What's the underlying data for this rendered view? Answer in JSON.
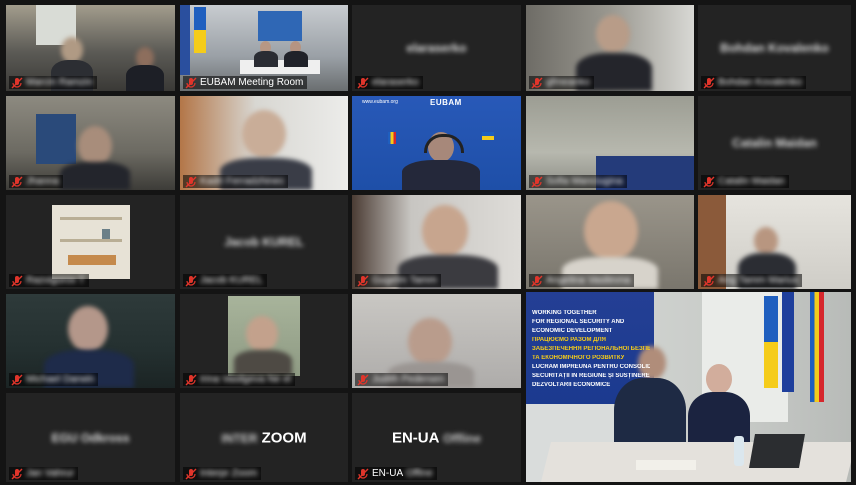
{
  "meeting": {
    "app": "ZOOM",
    "tiles": [
      {
        "id": "t1",
        "name": "Marcin Ramzin",
        "blurred": true,
        "video": true,
        "muted": true
      },
      {
        "id": "t2",
        "name": "EUBAM Meeting Room",
        "blurred": false,
        "video": true,
        "muted": true
      },
      {
        "id": "t3",
        "name": "elaraserko",
        "blurred": true,
        "video": false,
        "muted": true,
        "center_text": "elaraserko"
      },
      {
        "id": "t4",
        "name": "gfmeanko",
        "blurred": true,
        "video": true,
        "muted": true
      },
      {
        "id": "t5",
        "name": "Bohdan Kovalenko",
        "blurred": true,
        "video": false,
        "muted": true,
        "center_text": "Bohdan Kovalenko"
      },
      {
        "id": "t6",
        "name": "Jhanna",
        "blurred": true,
        "video": true,
        "muted": true
      },
      {
        "id": "t7",
        "name": "Kadri Ferradzhinec",
        "blurred": true,
        "video": true,
        "muted": true
      },
      {
        "id": "t8",
        "name": "",
        "blurred": false,
        "video": true,
        "muted": false,
        "banner_title": "EUBAM",
        "banner_url": "www.eubam.org"
      },
      {
        "id": "t9",
        "name": "Sofia Manciugina",
        "blurred": true,
        "video": true,
        "muted": true
      },
      {
        "id": "t10",
        "name": "Catalin Maidan",
        "blurred": true,
        "video": false,
        "muted": true,
        "center_text": "Catalin Maidan"
      },
      {
        "id": "t11",
        "name": "Razvigorov T",
        "blurred": true,
        "video": true,
        "muted": true
      },
      {
        "id": "t12",
        "name": "Jacob KUREL",
        "blurred": true,
        "video": false,
        "muted": true,
        "center_text": "Jacob KUREL"
      },
      {
        "id": "t13",
        "name": "Gugelm Tamm",
        "blurred": true,
        "video": true,
        "muted": true
      },
      {
        "id": "t14",
        "name": "Angelina Vasilevna",
        "blurred": true,
        "video": true,
        "muted": true
      },
      {
        "id": "t15",
        "name": "Ang Tamm Marius",
        "blurred": true,
        "video": true,
        "muted": true
      },
      {
        "id": "t16",
        "name": "Michael Darwin",
        "blurred": true,
        "video": true,
        "muted": true
      },
      {
        "id": "t17",
        "name": "Irina Vasilgeva Ne el",
        "blurred": true,
        "video": true,
        "muted": true
      },
      {
        "id": "t18",
        "name": "Judith Pedersen",
        "blurred": true,
        "video": true,
        "muted": true
      },
      {
        "id": "t19",
        "name": "",
        "blurred": false,
        "video": true,
        "muted": false,
        "slide_lines": [
          "WORKING TOGETHER",
          "FOR REGIONAL SECURITY AND",
          "ECONOMIC DEVELOPMENT",
          "ПРАЦЮЄМО РАЗОМ ДЛЯ",
          "ЗАБЕЗПЕЧЕННЯ РЕГІОНАЛЬНОЇ БЕЗПЕКИ",
          "ТА ЕКОНОМІЧНОГО РОЗВИТКУ",
          "LUCRĂM ÎMPREUNĂ PENTRU CONSOLIDAREA",
          "SECURITĂȚII ÎN REGIUNE ȘI SUSȚINEREA",
          "DEZVOLTĂRII ECONOMICE"
        ]
      },
      {
        "id": "t20",
        "name": "Jan Vahrur",
        "blurred": true,
        "video": false,
        "muted": true,
        "center_text": "EGU Odkross"
      },
      {
        "id": "t21",
        "name": "Interpr Zoom",
        "blurred": true,
        "video": false,
        "muted": true,
        "center_text": "ZOOM",
        "center_prefix": "INTER"
      },
      {
        "id": "t22",
        "name": "EN-UA",
        "blurred": false,
        "video": false,
        "muted": true,
        "center_text": "EN-UA",
        "name_suffix": "Offine",
        "center_suffix": "Offline"
      }
    ]
  },
  "colors": {
    "background": "#141414",
    "tile": "#232323",
    "mic_muted": "#e0352b",
    "eubam_blue": "#1e4fa8",
    "ua_blue": "#1f5fbf",
    "ua_yellow": "#f5cc1a",
    "md_red": "#d6262c"
  }
}
